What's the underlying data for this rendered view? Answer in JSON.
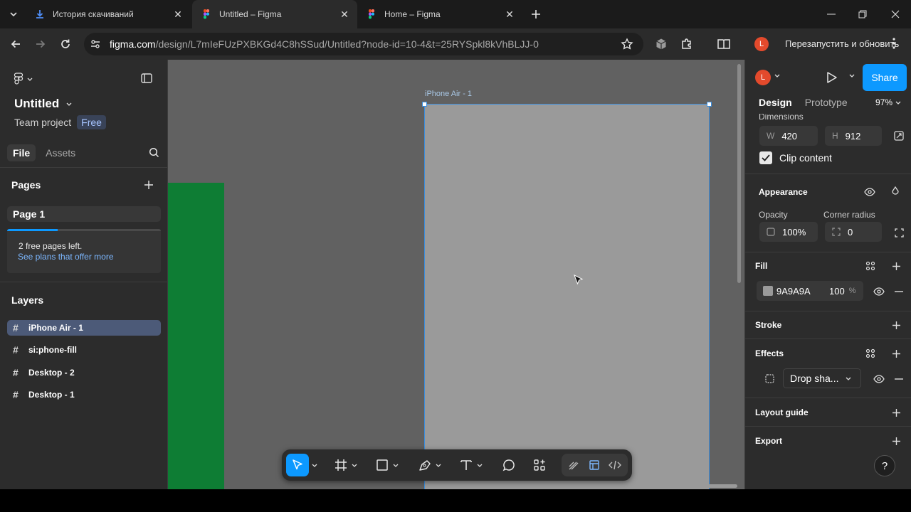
{
  "browser": {
    "tabs": [
      {
        "title": "История скачиваний",
        "active": false
      },
      {
        "title": "Untitled – Figma",
        "active": true
      },
      {
        "title": "Home – Figma",
        "active": false
      }
    ],
    "url_host": "figma.com",
    "url_path": "/design/L7mIeFUzPXBKGd4C8hSSud/Untitled?node-id=10-4&t=25RYSpkl8kVhBLJJ-0",
    "profile_letter": "L",
    "relaunch_label": "Перезапустить и обновить"
  },
  "left_panel": {
    "file_title": "Untitled",
    "project": "Team project",
    "plan_badge": "Free",
    "tabs": [
      "File",
      "Assets"
    ],
    "pages_heading": "Pages",
    "page_name": "Page 1",
    "quota_fraction": 0.33,
    "quota_text": "2 free pages left.",
    "quota_link": "See plans that offer more",
    "layers_heading": "Layers",
    "layers": [
      {
        "name": "iPhone Air - 1",
        "selected": true
      },
      {
        "name": "si:phone-fill",
        "selected": false
      },
      {
        "name": "Desktop - 2",
        "selected": false
      },
      {
        "name": "Desktop - 1",
        "selected": false
      }
    ]
  },
  "canvas": {
    "frame_label": "iPhone Air - 1",
    "frame_color": "#9A9A9A",
    "green_color": "#0E7D34",
    "selection_color": "#3B8FE0",
    "tools": [
      "move-tool",
      "frame-tool",
      "shape-tool",
      "pen-tool",
      "text-tool",
      "comment-tool",
      "actions-tool",
      "draw-mode",
      "design-mode",
      "dev-mode"
    ]
  },
  "right_panel": {
    "avatar_letter": "L",
    "share_label": "Share",
    "tabs": [
      "Design",
      "Prototype"
    ],
    "zoom": "97%",
    "dimensions_label": "Dimensions",
    "width_prefix": "W",
    "width": "420",
    "height_prefix": "H",
    "height": "912",
    "clip_content_label": "Clip content",
    "clip_content_checked": true,
    "appearance_heading": "Appearance",
    "opacity_label": "Opacity",
    "opacity": "100%",
    "corner_radius_label": "Corner radius",
    "corner_radius": "0",
    "fill_heading": "Fill",
    "fill_hex": "9A9A9A",
    "fill_opacity": "100",
    "fill_opacity_unit": "%",
    "stroke_heading": "Stroke",
    "effects_heading": "Effects",
    "effect_name": "Drop sha...",
    "layout_guide_heading": "Layout guide",
    "export_heading": "Export",
    "help_label": "?"
  },
  "colors": {
    "accent": "#0D99FF",
    "panel": "#2C2C2C",
    "canvas": "#616161"
  }
}
